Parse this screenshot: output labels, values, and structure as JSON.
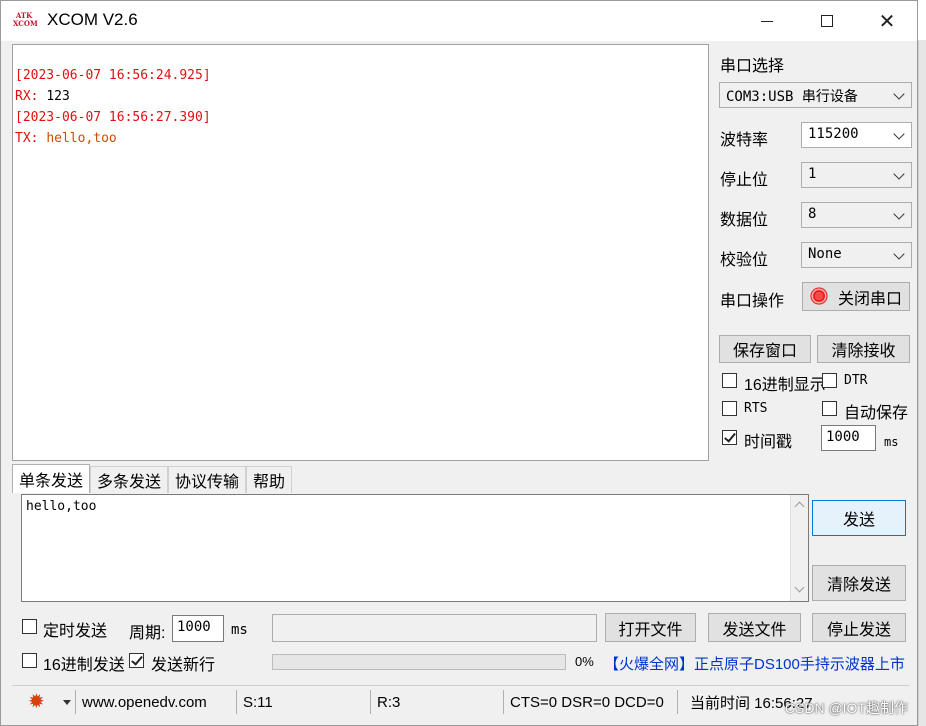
{
  "window": {
    "logo_top": "ATK",
    "logo_bottom": "XCOM",
    "title": "XCOM V2.6"
  },
  "receive": {
    "lines": [
      {
        "text": "[2023-06-07 16:56:24.925]"
      },
      {
        "prefix": "RX: ",
        "text": "123"
      },
      {
        "text": "[2023-06-07 16:56:27.390]"
      },
      {
        "prefix": "TX: ",
        "text": "hello,too"
      }
    ]
  },
  "serial": {
    "section_label": "串口选择",
    "port_value": "COM3:USB 串行设备",
    "baud_label": "波特率",
    "baud_value": "115200",
    "stop_label": "停止位",
    "stop_value": "1",
    "data_label": "数据位",
    "data_value": "8",
    "parity_label": "校验位",
    "parity_value": "None",
    "op_label": "串口操作",
    "op_button": "关闭串口"
  },
  "right_buttons": {
    "save_window": "保存窗口",
    "clear_receive": "清除接收"
  },
  "options": {
    "hex_display": {
      "label": "16进制显示",
      "checked": false
    },
    "dtr": {
      "label": "DTR",
      "checked": false
    },
    "rts": {
      "label": "RTS",
      "checked": false
    },
    "auto_save": {
      "label": "自动保存",
      "checked": false
    },
    "timestamp": {
      "label": "时间戳",
      "checked": true
    },
    "timestamp_ms": "1000",
    "ms_unit": "ms"
  },
  "tabs": [
    "单条发送",
    "多条发送",
    "协议传输",
    "帮助"
  ],
  "send": {
    "text": "hello,too",
    "send_button": "发送",
    "clear_send_button": "清除发送",
    "timed_send": {
      "label": "定时发送",
      "checked": false
    },
    "period_label": "周期:",
    "period_value": "1000",
    "period_unit": "ms",
    "open_file": "打开文件",
    "send_file": "发送文件",
    "stop_send": "停止发送",
    "hex_send": {
      "label": "16进制发送",
      "checked": false
    },
    "newline": {
      "label": "发送新行",
      "checked": true
    },
    "progress_percent": 0,
    "progress_text": "0%",
    "ad_text": "【火爆全网】正点原子DS100手持示波器上市"
  },
  "statusbar": {
    "url": "www.openedv.com",
    "sent": "S:11",
    "received": "R:3",
    "lines": "CTS=0 DSR=0 DCD=0",
    "time": "当前时间 16:56:27"
  },
  "watermark": "CSDN @IOT趣制作",
  "colors": {
    "timestamp": "#e01010",
    "tx": "#d04a00",
    "accent": "#0078d7",
    "ad": "#0033cc"
  }
}
